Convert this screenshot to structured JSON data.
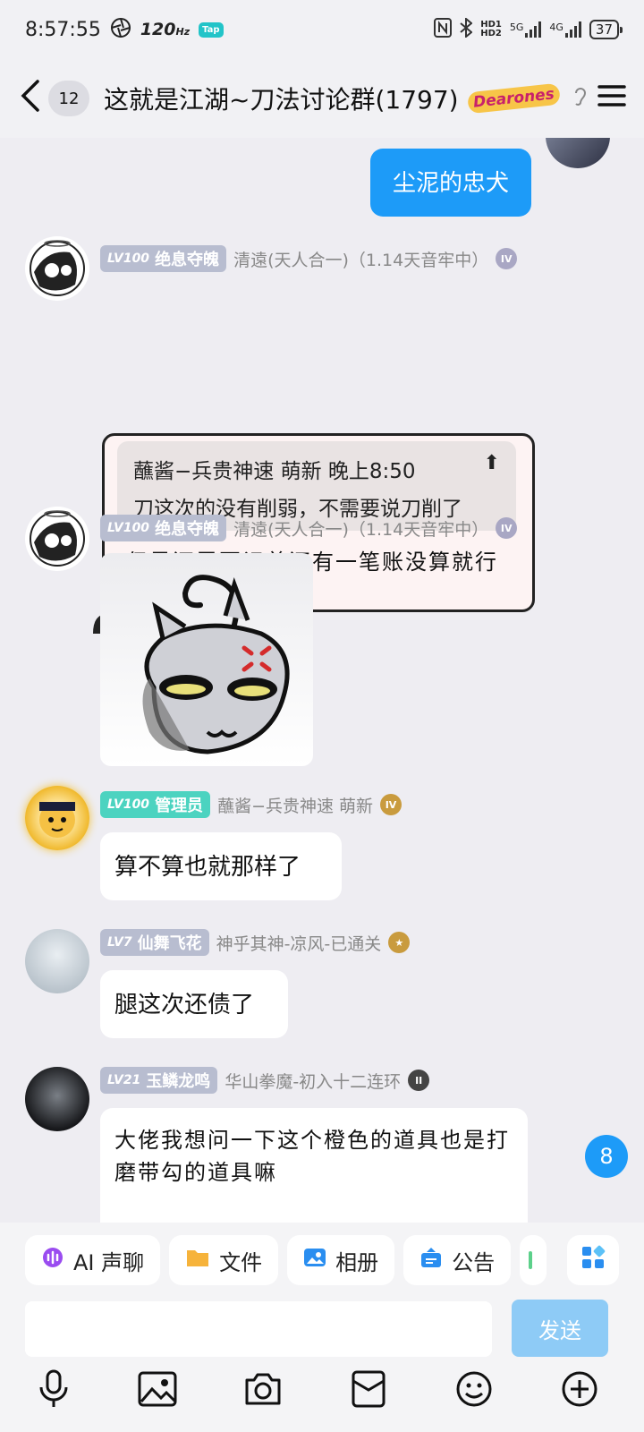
{
  "status": {
    "time": "8:57:55",
    "refresh": "120",
    "refresh_unit": "Hz",
    "tap": "Tap",
    "net1": "5G",
    "net2": "4G",
    "battery": "37"
  },
  "header": {
    "unread": "12",
    "title": "这就是江湖~刀法讨论群(1797)",
    "badge": "Dearones"
  },
  "messages": {
    "mine": {
      "text": "尘泥的忠犬"
    },
    "m1": {
      "level": "LV100",
      "nick": "绝息夺魄",
      "title": "清遠(天人合一)（1.14天音牢中）",
      "medal": "IV",
      "quote_author": "蘸酱−兵贵神速 萌新 晚上8:50",
      "quote_text": "刀这次的没有削弱，不需要说刀削了",
      "quote_arrow": "⬆",
      "body": "但是还需要记着还有一笔账没算就行了"
    },
    "m2": {
      "level": "LV100",
      "nick": "绝息夺魄",
      "title": "清遠(天人合一)（1.14天音牢中）",
      "medal": "IV"
    },
    "m3": {
      "level": "LV100",
      "nick": "管理员",
      "title": "蘸酱−兵贵神速 萌新",
      "medal": "IV",
      "text": "算不算也就那样了"
    },
    "m4": {
      "level": "LV7",
      "nick": "仙舞飞花",
      "title": "神乎其神-凉风-已通关",
      "text": "腿这次还债了"
    },
    "m5": {
      "level": "LV21",
      "nick": "玉鳞龙鸣",
      "title": "华山拳魔-初入十二连环",
      "medal": "II",
      "text": "大佬我想问一下这个橙色的道具也是打磨带勾的道具嘛"
    }
  },
  "new_count": "8",
  "quickbar": {
    "ai": "AI 声聊",
    "file": "文件",
    "album": "相册",
    "notice": "公告",
    "send": "发送",
    "input_placeholder": ""
  },
  "icons": {
    "back": "chevron-left-icon",
    "menu": "hamburger-icon",
    "ear": "ear-icon"
  }
}
